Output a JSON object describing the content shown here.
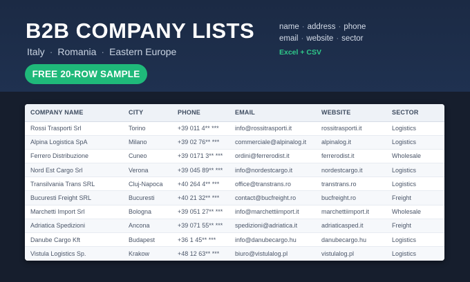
{
  "hero": {
    "title": "B2B COMPANY LISTS",
    "regions": [
      "Italy",
      "Romania",
      "Eastern Europe"
    ],
    "region_separator": "·",
    "cta_label": "FREE 20-ROW SAMPLE",
    "fields_line1": [
      "name",
      "address",
      "phone"
    ],
    "fields_line2": [
      "email",
      "website",
      "sector"
    ],
    "field_separator": "·",
    "formats": "Excel + CSV"
  },
  "colors": {
    "hero_bg": "#1b2a44",
    "page_bg": "#161e2d",
    "accent_green": "#1fb97a",
    "header_row": "#eef2f7"
  },
  "table": {
    "headers": [
      "COMPANY NAME",
      "CITY",
      "PHONE",
      "EMAIL",
      "WEBSITE",
      "SECTOR"
    ],
    "rows": [
      [
        "Rossi Trasporti Srl",
        "Torino",
        "+39 011 4** ***",
        "info@rossitrasporti.it",
        "rossitrasporti.it",
        "Logistics"
      ],
      [
        "Alpina Logistica SpA",
        "Milano",
        "+39 02 76** ***",
        "commerciale@alpinalog.it",
        "alpinalog.it",
        "Logistics"
      ],
      [
        "Ferrero Distribuzione",
        "Cuneo",
        "+39 0171 3** ***",
        "ordini@ferrerodist.it",
        "ferrerodist.it",
        "Wholesale"
      ],
      [
        "Nord Est Cargo Srl",
        "Verona",
        "+39 045 89** ***",
        "info@nordestcargo.it",
        "nordestcargo.it",
        "Logistics"
      ],
      [
        "Transilvania Trans SRL",
        "Cluj-Napoca",
        "+40 264 4** ***",
        "office@transtrans.ro",
        "transtrans.ro",
        "Logistics"
      ],
      [
        "Bucuresti Freight SRL",
        "Bucuresti",
        "+40 21 32** ***",
        "contact@bucfreight.ro",
        "bucfreight.ro",
        "Freight"
      ],
      [
        "Marchetti Import Srl",
        "Bologna",
        "+39 051 27** ***",
        "info@marchettiimport.it",
        "marchettiimport.it",
        "Wholesale"
      ],
      [
        "Adriatica Spedizioni",
        "Ancona",
        "+39 071 55** ***",
        "spedizioni@adriatica.it",
        "adriaticasped.it",
        "Freight"
      ],
      [
        "Danube Cargo Kft",
        "Budapest",
        "+36 1 45** ***",
        "info@danubecargo.hu",
        "danubecargo.hu",
        "Logistics"
      ],
      [
        "Vistula Logistics Sp.",
        "Krakow",
        "+48 12 63** ***",
        "biuro@vistulalog.pl",
        "vistulalog.pl",
        "Logistics"
      ]
    ]
  }
}
